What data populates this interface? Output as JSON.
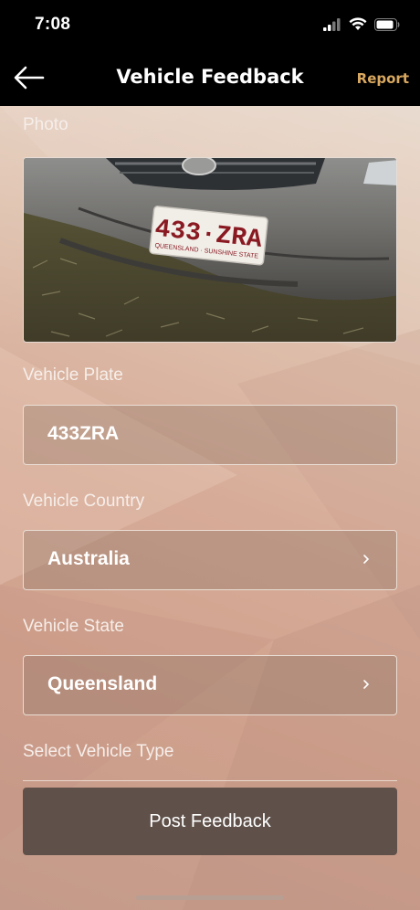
{
  "status_bar": {
    "time": "7:08",
    "icons": [
      "signal-icon",
      "wifi-icon",
      "battery-icon"
    ]
  },
  "nav": {
    "back_icon": "back-arrow-icon",
    "title": "Vehicle Feedback",
    "report_label": "Report",
    "report_color": "#d9a860"
  },
  "form": {
    "photo_label": "Photo",
    "photo_plate_text": "433·ZRA",
    "photo_plate_subtext": "QUEENSLAND · SUNSHINE STATE",
    "plate_label": "Vehicle Plate",
    "plate_value": "433ZRA",
    "country_label": "Vehicle Country",
    "country_value": "Australia",
    "state_label": "Vehicle State",
    "state_value": "Queensland",
    "type_label": "Select Vehicle Type"
  },
  "actions": {
    "post_label": "Post Feedback"
  }
}
